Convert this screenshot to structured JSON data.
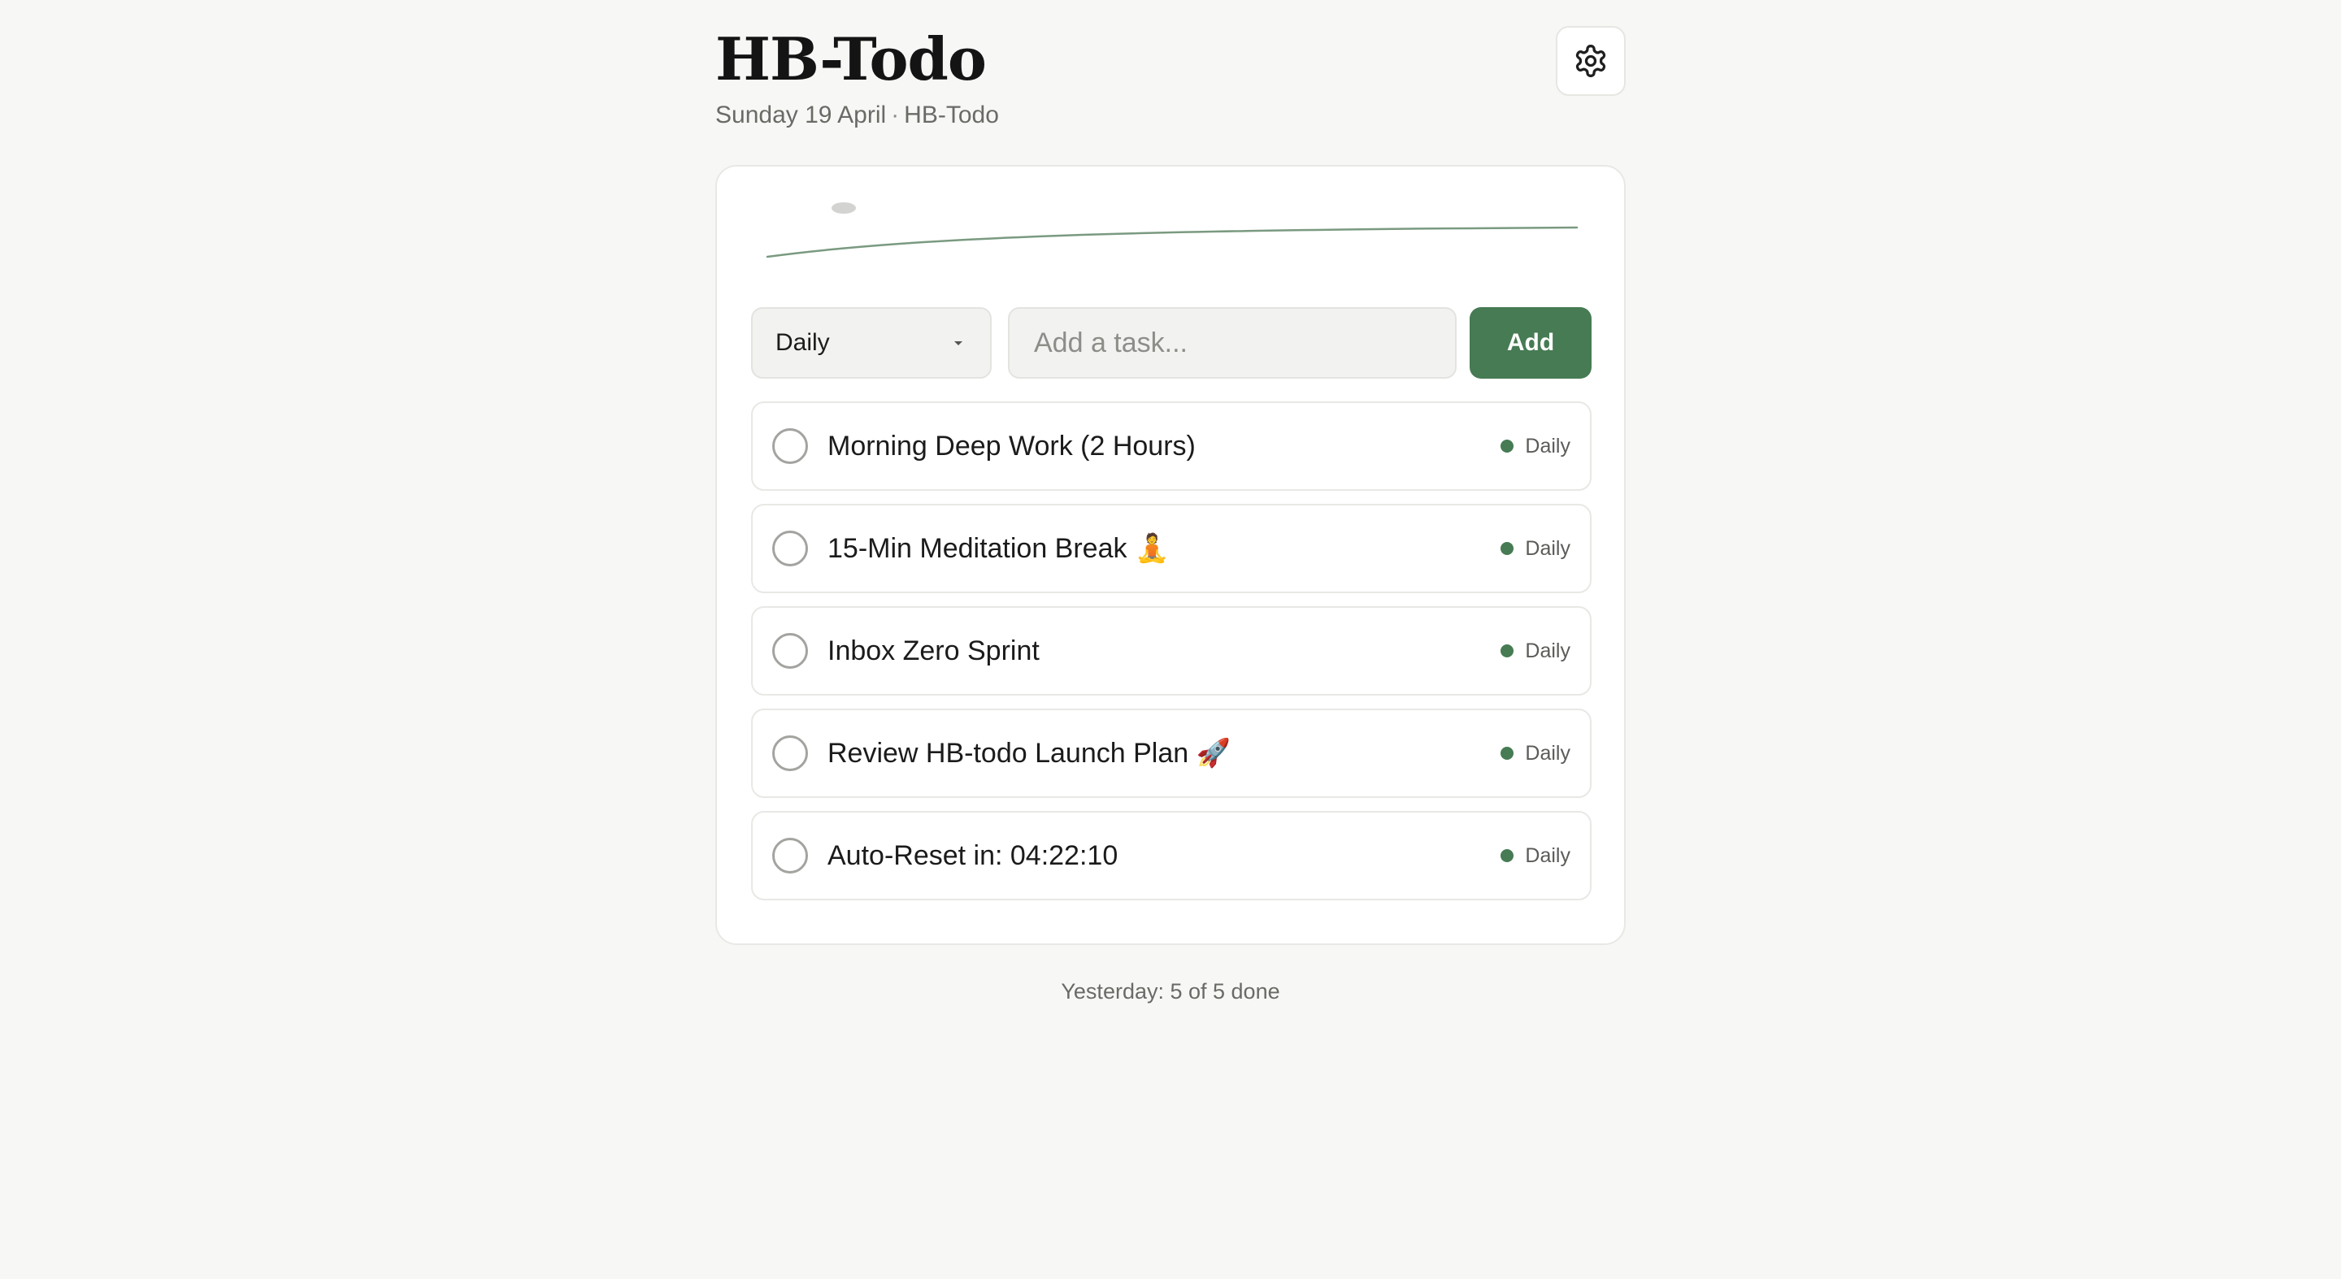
{
  "app": {
    "title": "HB-Todo",
    "date": "Sunday 19 April",
    "separator": "·",
    "subtitle_app": "HB-Todo"
  },
  "header": {
    "settings_icon": "gear-icon"
  },
  "controls": {
    "frequency_selected": "Daily",
    "task_placeholder": "Add a task...",
    "task_value": "",
    "add_label": "Add"
  },
  "tasks": [
    {
      "text": "Morning Deep Work (2 Hours)",
      "tag": "Daily",
      "done": false
    },
    {
      "text": "15-Min Meditation Break 🧘",
      "tag": "Daily",
      "done": false
    },
    {
      "text": "Inbox Zero Sprint",
      "tag": "Daily",
      "done": false
    },
    {
      "text": "Review HB-todo Launch Plan 🚀",
      "tag": "Daily",
      "done": false
    },
    {
      "text": "Auto-Reset in: 04:22:10",
      "tag": "Daily",
      "done": false
    }
  ],
  "footer": {
    "summary": "Yesterday: 5 of 5 done"
  },
  "colors": {
    "accent": "#467b53",
    "background": "#f7f7f5",
    "card": "#ffffff",
    "sparkline": "#7a9a80"
  }
}
